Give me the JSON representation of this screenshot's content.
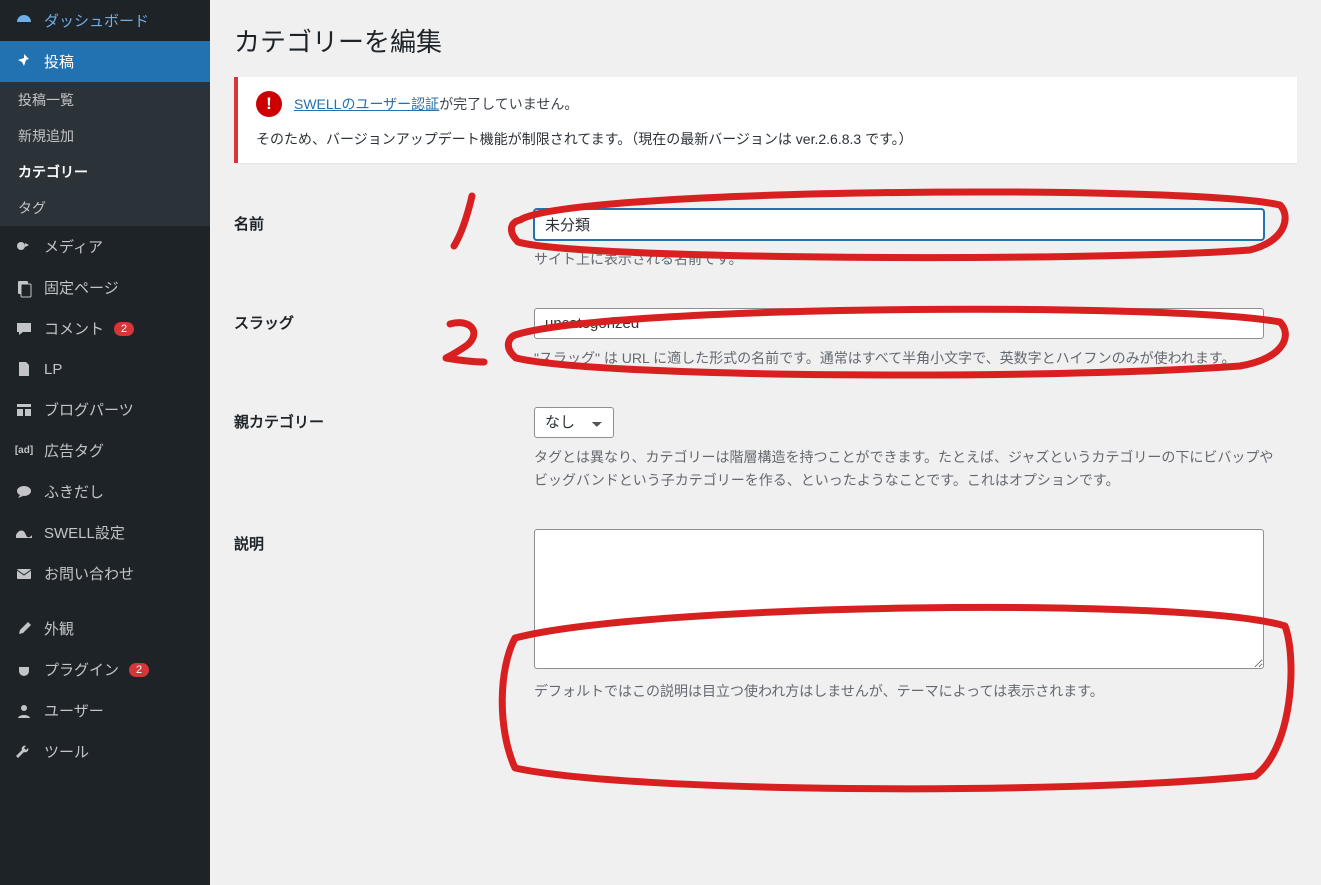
{
  "sidebar": {
    "items": [
      {
        "id": "dashboard",
        "icon": "gauge",
        "label": "ダッシュボード"
      },
      {
        "id": "posts",
        "icon": "pin",
        "label": "投稿",
        "active": true
      },
      {
        "id": "media",
        "icon": "media",
        "label": "メディア"
      },
      {
        "id": "pages",
        "icon": "pages",
        "label": "固定ページ"
      },
      {
        "id": "comments",
        "icon": "comment",
        "label": "コメント",
        "badge": "2"
      },
      {
        "id": "lp",
        "icon": "doc",
        "label": "LP"
      },
      {
        "id": "blogparts",
        "icon": "grid",
        "label": "ブログパーツ"
      },
      {
        "id": "adtag",
        "icon": "ad",
        "label": "広告タグ"
      },
      {
        "id": "speech",
        "icon": "bubble",
        "label": "ふきだし"
      },
      {
        "id": "swell",
        "icon": "swell",
        "label": "SWELL設定"
      },
      {
        "id": "contact",
        "icon": "mail",
        "label": "お問い合わせ"
      },
      {
        "id": "appearance",
        "icon": "brush",
        "label": "外観"
      },
      {
        "id": "plugins",
        "icon": "plug",
        "label": "プラグイン",
        "badge": "2"
      },
      {
        "id": "users",
        "icon": "user",
        "label": "ユーザー"
      },
      {
        "id": "tools",
        "icon": "wrench",
        "label": "ツール"
      }
    ],
    "posts_submenu": [
      {
        "id": "all",
        "label": "投稿一覧"
      },
      {
        "id": "new",
        "label": "新規追加"
      },
      {
        "id": "cat",
        "label": "カテゴリー",
        "current": true
      },
      {
        "id": "tag",
        "label": "タグ"
      }
    ]
  },
  "page_title": "カテゴリーを編集",
  "notice": {
    "link_text": "SWELLのユーザー認証",
    "line1_suffix": "が完了していません。",
    "line2": "そのため、バージョンアップデート機能が制限されてます。（現在の最新バージョンは ver.2.6.8.3 です。）"
  },
  "form": {
    "name": {
      "label": "名前",
      "value": "未分類",
      "desc": "サイト上に表示される名前です。"
    },
    "slug": {
      "label": "スラッグ",
      "value": "uncategorized",
      "desc": "\"スラッグ\" は URL に適した形式の名前です。通常はすべて半角小文字で、英数字とハイフンのみが使われます。"
    },
    "parent": {
      "label": "親カテゴリー",
      "selected": "なし",
      "desc": "タグとは異なり、カテゴリーは階層構造を持つことができます。たとえば、ジャズというカテゴリーの下にビバップやビッグバンドという子カテゴリーを作る、といったようなことです。これはオプションです。"
    },
    "description": {
      "label": "説明",
      "value": "",
      "desc": "デフォルトではこの説明は目立つ使われ方はしませんが、テーマによっては表示されます。"
    }
  },
  "annotations": {
    "mark1": "1",
    "mark2": "2"
  }
}
